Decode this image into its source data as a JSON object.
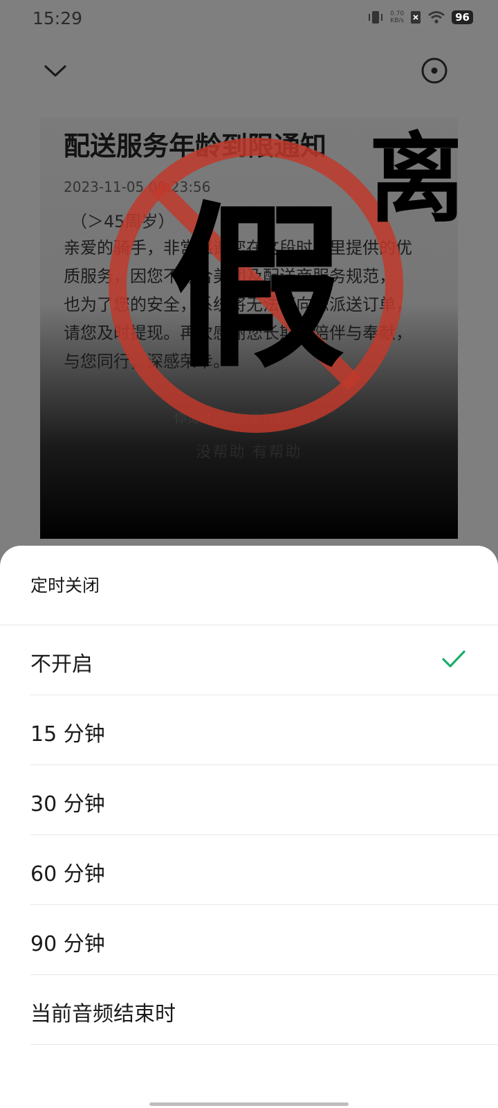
{
  "status_bar": {
    "time": "15:29",
    "net_speed_value": "0.70",
    "net_speed_unit": "KB/s",
    "battery": "96"
  },
  "topbar": {
    "back_icon": "chevron-down-icon",
    "more_icon": "target-circle-icon"
  },
  "media": {
    "title": "配送服务年龄到限通知",
    "date": "2023-11-05 00:23:56",
    "subtitle": "（＞45周岁）",
    "body_lines": [
      "亲爱的骑手，非常感谢您在这段时间里提供的优",
      "质服务，因您不符合美团及配送商服务规范，",
      "也为了您的安全，系统将无法再向您派送订单，",
      "请您及时提现。再次感谢您长期的陪伴与奉献，",
      "与您同行，深感荣幸。"
    ],
    "feedback_question": "你觉得这条信息有帮助吗？",
    "feedback_options": "没帮助   有帮助",
    "stamp_text": "假",
    "side_text": "离",
    "stamp_color": "#c0392b"
  },
  "sheet": {
    "title": "定时关闭",
    "options": [
      {
        "label": "不开启",
        "selected": true
      },
      {
        "label": "15 分钟",
        "selected": false
      },
      {
        "label": "30 分钟",
        "selected": false
      },
      {
        "label": "60 分钟",
        "selected": false
      },
      {
        "label": "90 分钟",
        "selected": false
      },
      {
        "label": "当前音频结束时",
        "selected": false
      }
    ],
    "check_color": "#1aad6b"
  }
}
